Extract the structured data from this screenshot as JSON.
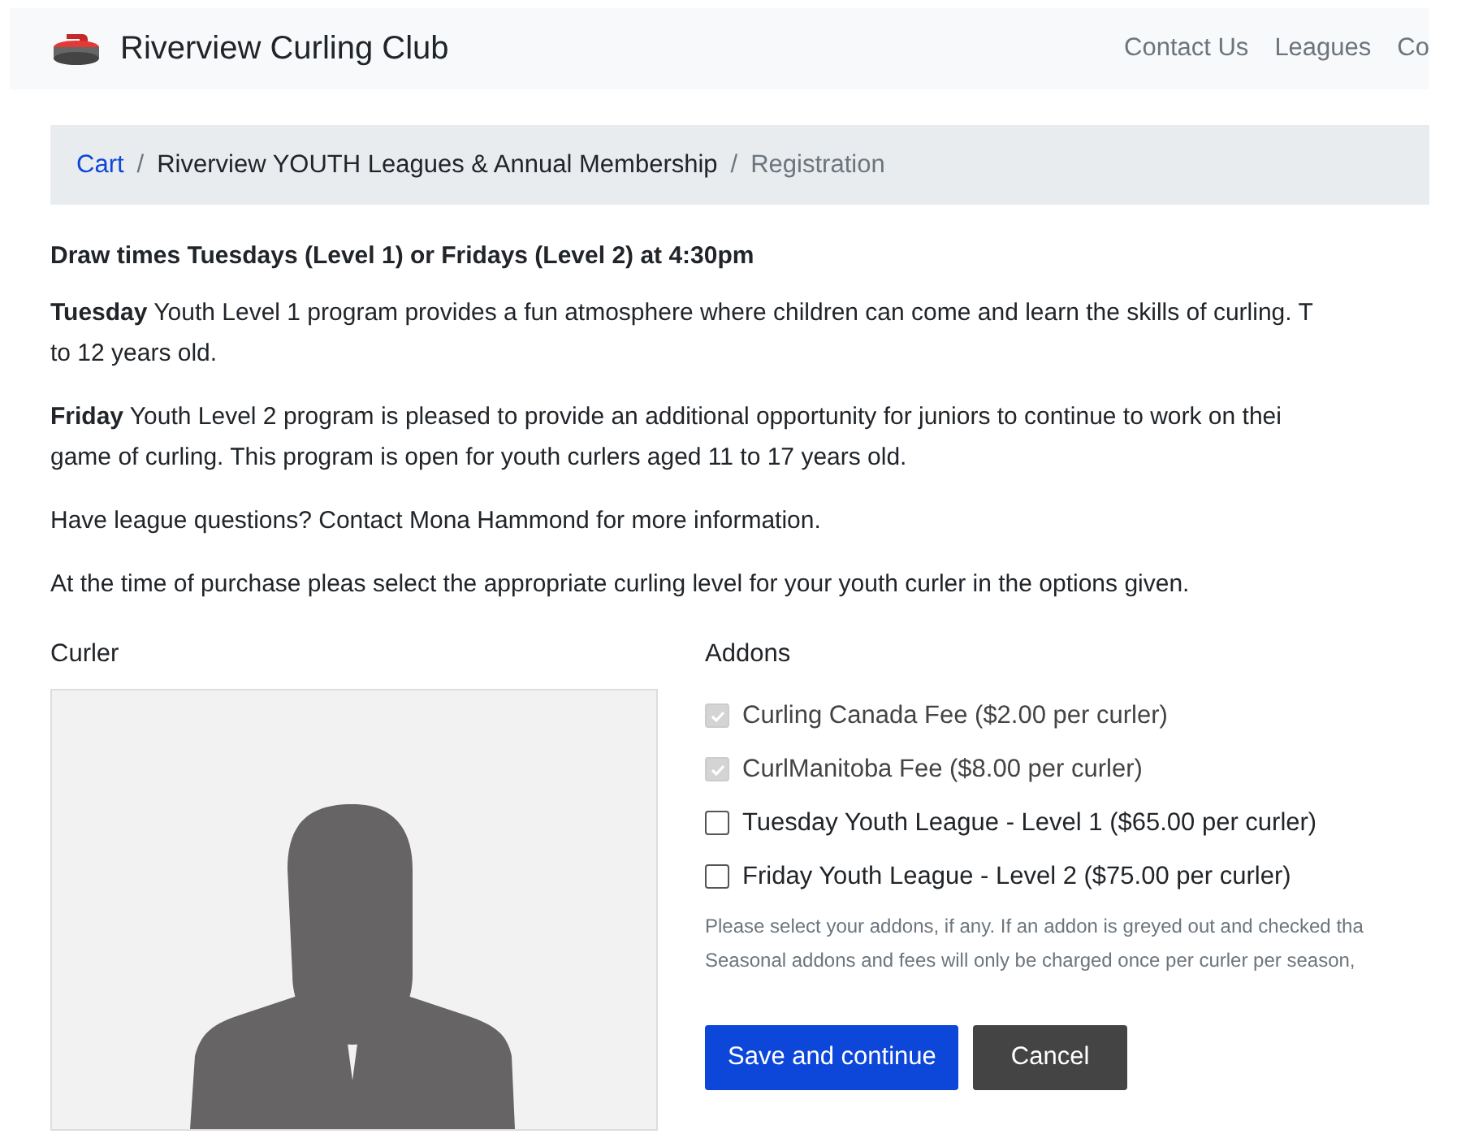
{
  "navbar": {
    "brand": "Riverview Curling Club",
    "links": [
      "Contact Us",
      "Leagues",
      "Co"
    ]
  },
  "breadcrumb_separator": "/",
  "breadcrumb": [
    {
      "label": "Cart",
      "kind": "link"
    },
    {
      "label": "Riverview YOUTH Leagues & Annual Membership",
      "kind": "link"
    },
    {
      "label": "Registration",
      "kind": "current"
    }
  ],
  "heading": "Draw times Tuesdays (Level 1) or Fridays (Level 2) at 4:30pm",
  "paragraphs": [
    "**Tuesday** Youth Level 1 program provides a fun atmosphere where children can come and learn the skills of curling. T\nto 12 years old.",
    "**Friday** Youth Level 2 program is pleased to provide an additional opportunity for juniors to continue to work on thei\ngame of curling. This program is open for youth curlers aged 11 to 17 years old.",
    "Have league questions? Contact Mona Hammond for more information.",
    "At the time of purchase pleas select the appropriate curling level for your youth curler in the options given."
  ],
  "curler": {
    "label": "Curler"
  },
  "addons": {
    "label": "Addons",
    "items": [
      {
        "label": "Curling Canada Fee ($2.00 per curler)",
        "checked": true,
        "disabled": true
      },
      {
        "label": "CurlManitoba Fee ($8.00 per curler)",
        "checked": true,
        "disabled": true
      },
      {
        "label": "Tuesday Youth League - Level 1 ($65.00 per curler)",
        "checked": false,
        "disabled": false
      },
      {
        "label": "Friday Youth League - Level 2 ($75.00 per curler)",
        "checked": false,
        "disabled": false
      }
    ],
    "help": "Please select your addons, if any. If an addon is greyed out and checked tha\nSeasonal addons and fees will only be charged once per curler per season,"
  },
  "buttons": [
    {
      "label": "Save and continue",
      "kind": "primary"
    },
    {
      "label": "Cancel",
      "kind": "secondary"
    }
  ]
}
